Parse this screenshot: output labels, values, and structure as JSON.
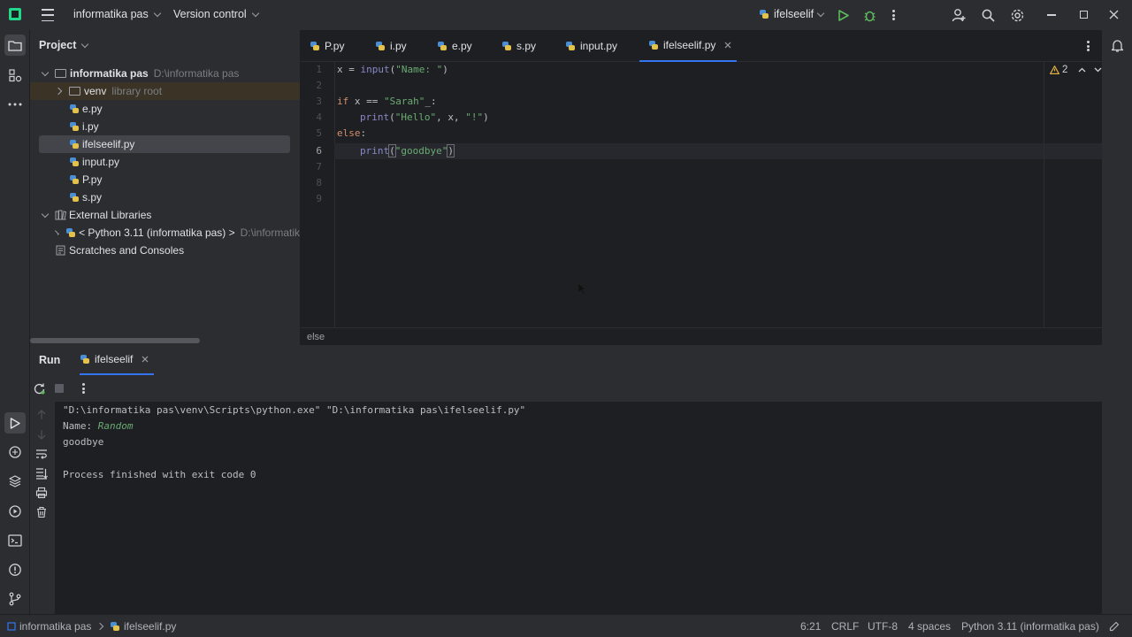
{
  "titlebar": {
    "project_name": "informatika pas",
    "vcs_label": "Version control",
    "run_config": "ifelseelif"
  },
  "project_panel": {
    "header": "Project",
    "root": {
      "name": "informatika pas",
      "path": "D:\\informatika pas"
    },
    "venv": {
      "name": "venv",
      "hint": "library root"
    },
    "files": [
      "e.py",
      "i.py",
      "ifelseelif.py",
      "input.py",
      "P.py",
      "s.py"
    ],
    "external_libraries": "External Libraries",
    "python_lib": {
      "name": "< Python 3.11 (informatika pas) >",
      "path": "D:\\informatik"
    },
    "scratches": "Scratches and Consoles"
  },
  "editor": {
    "tabs": [
      "P.py",
      "i.py",
      "e.py",
      "s.py",
      "input.py",
      "ifelseelif.py"
    ],
    "active_tab": "ifelseelif.py",
    "line_numbers": [
      "1",
      "2",
      "3",
      "4",
      "5",
      "6",
      "7",
      "8",
      "9"
    ],
    "code": {
      "l1_a": "x = ",
      "l1_fn": "input",
      "l1_b": "(",
      "l1_str": "\"Name: \"",
      "l1_c": ")",
      "l3_kw": "if",
      "l3_a": " x == ",
      "l3_str": "\"Sarah\"",
      "l3_b": "_:",
      "l4_fn": "print",
      "l4_a": "(",
      "l4_str1": "\"Hello\"",
      "l4_b": ", x, ",
      "l4_str2": "\"!\"",
      "l4_c": ")",
      "l5_kw": "else",
      "l5_a": ":",
      "l6_fn": "print",
      "l6_a": "(",
      "l6_str": "\"goodbye\"",
      "l6_b": ")"
    },
    "warning_count": "2",
    "breadcrumb": "else"
  },
  "run_panel": {
    "title": "Run",
    "tab_label": "ifelseelif",
    "console": {
      "command": "\"D:\\informatika pas\\venv\\Scripts\\python.exe\" \"D:\\informatika pas\\ifelseelif.py\"",
      "prompt": "Name: ",
      "user_input": "Random",
      "output": "goodbye",
      "exit_message": "Process finished with exit code 0"
    }
  },
  "statusbar": {
    "project": "informatika pas",
    "file": "ifelseelif.py",
    "cursor": "6:21",
    "line_sep": "CRLF",
    "encoding": "UTF-8",
    "indent": "4 spaces",
    "interpreter": "Python 3.11 (informatika pas)"
  },
  "colors": {
    "accent_green": "#5fb85f",
    "string_green": "#6aab73",
    "keyword_orange": "#cf8e6d",
    "builtin_purple": "#8888c6",
    "warning_yellow": "#e0b040"
  }
}
